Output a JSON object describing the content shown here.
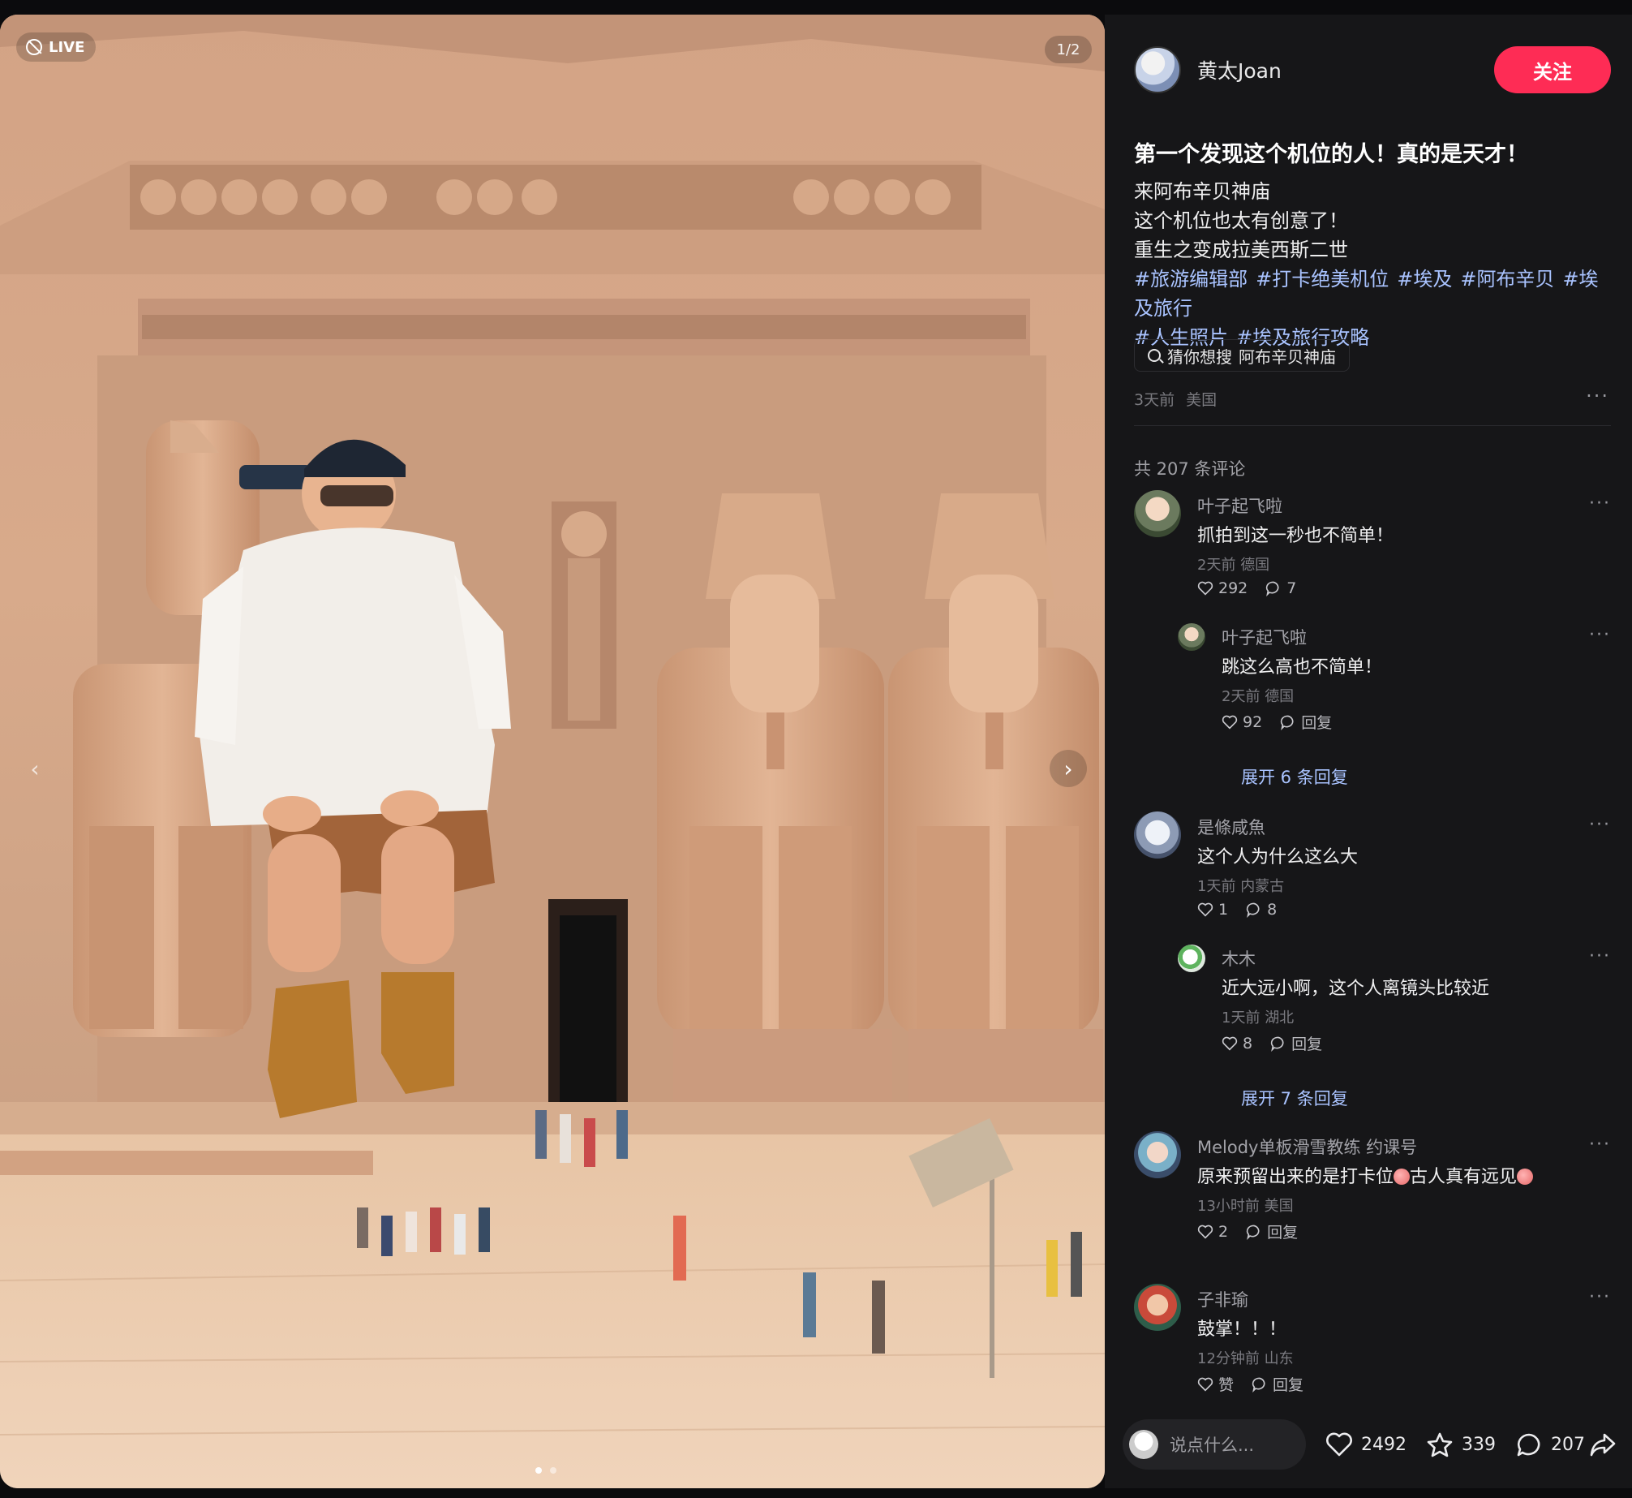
{
  "media": {
    "live_label": "LIVE",
    "page_indicator": "1/2",
    "prev_icon": "chevron-left-icon",
    "next_icon": "chevron-right-icon",
    "carousel_dots": 2,
    "current_slide": 1
  },
  "author": {
    "name": "黄太Joan",
    "follow_label": "关注",
    "follow_color": "#fe2c55"
  },
  "post": {
    "title": "第一个发现这个机位的人！真的是天才！",
    "lines": [
      "来阿布辛贝神庙",
      "这个机位也太有创意了！",
      "重生之变成拉美西斯二世"
    ],
    "tags": [
      "#旅游编辑部",
      "#打卡绝美机位",
      "#埃及",
      "#阿布辛贝",
      "#埃及旅行",
      "#人生照片",
      "#埃及旅行攻略"
    ],
    "search_prefix": "猜你想搜",
    "search_term": "阿布辛贝神庙",
    "time": "3天前",
    "location": "美国",
    "tag_color": "#a9c3ff"
  },
  "comments_header": "共 207 条评论",
  "comments": [
    {
      "name": "叶子起飞啦",
      "text": "抓拍到这一秒也不简单！",
      "time": "2天前",
      "location": "德国",
      "likes": "292",
      "replies": "7",
      "reply": {
        "name": "叶子起飞啦",
        "text": "跳这么高也不简单！",
        "time": "2天前",
        "location": "德国",
        "likes": "92",
        "reply_label": "回复"
      },
      "expand": "展开 6 条回复"
    },
    {
      "name": "是條咸魚",
      "text": "这个人为什么这么大",
      "time": "1天前",
      "location": "内蒙古",
      "likes": "1",
      "replies": "8",
      "reply": {
        "name": "木木",
        "text": "近大远小啊，这个人离镜头比较近",
        "time": "1天前",
        "location": "湖北",
        "likes": "8",
        "reply_label": "回复"
      },
      "expand": "展开 7 条回复"
    },
    {
      "name": "Melody单板滑雪教练 约课号",
      "text_a": "原来预留出来的是打卡位",
      "text_b": "古人真有远见",
      "time": "13小时前",
      "location": "美国",
      "likes": "2",
      "reply_label": "回复"
    },
    {
      "name": "子非瑜",
      "text": "鼓掌！！！",
      "time": "12分钟前",
      "location": "山东",
      "likes_label": "赞",
      "reply_label": "回复"
    }
  ],
  "bottom": {
    "input_placeholder": "说点什么...",
    "like_count": "2492",
    "favorite_count": "339",
    "comment_count": "207",
    "share_icon": "share-icon"
  }
}
